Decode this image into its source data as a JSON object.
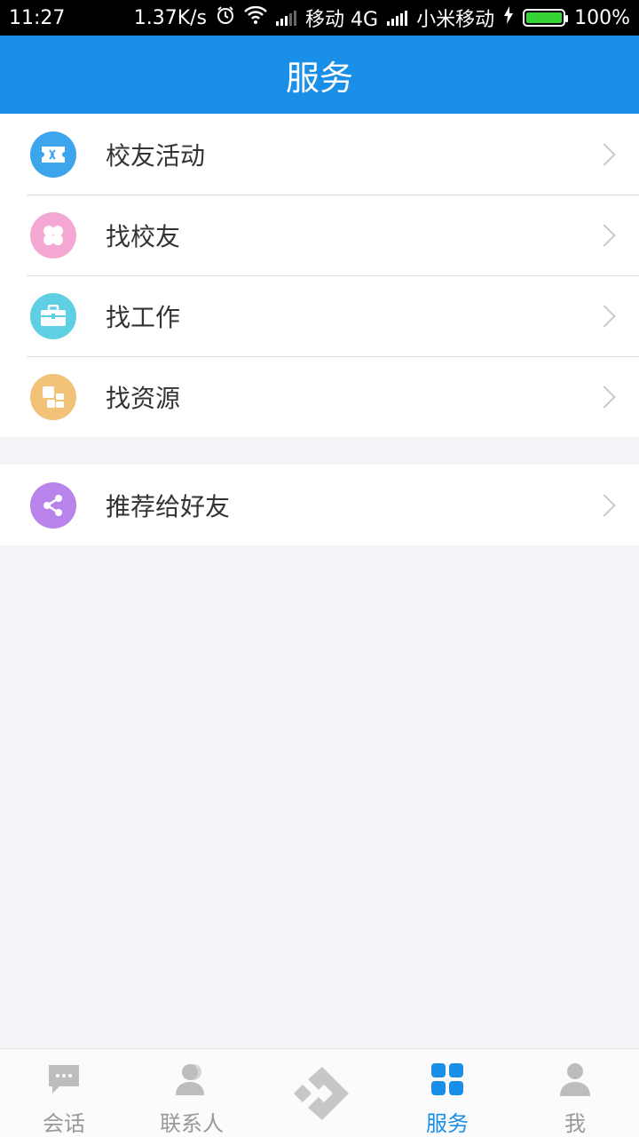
{
  "status_bar": {
    "time": "11:27",
    "speed": "1.37K/s",
    "carrier1": "移动 4G",
    "carrier2": "小米移动",
    "battery": "100%",
    "battery_level": 1.0
  },
  "header": {
    "title": "服务"
  },
  "menu_primary": [
    {
      "label": "校友活动",
      "icon": "ticket-icon",
      "color": "#3da5ec"
    },
    {
      "label": "找校友",
      "icon": "clover-icon",
      "color": "#f4a7d3"
    },
    {
      "label": "找工作",
      "icon": "briefcase-icon",
      "color": "#5fcfe4"
    },
    {
      "label": "找资源",
      "icon": "blocks-icon",
      "color": "#f1c278"
    }
  ],
  "menu_secondary": [
    {
      "label": "推荐给好友",
      "icon": "share-icon",
      "color": "#b883ea"
    }
  ],
  "tabbar": {
    "tabs": [
      {
        "label": "会话",
        "icon": "chat-icon"
      },
      {
        "label": "联系人",
        "icon": "contacts-icon"
      },
      {
        "label": "",
        "icon": "logo-icon"
      },
      {
        "label": "服务",
        "icon": "services-grid-icon",
        "active": true
      },
      {
        "label": "我",
        "icon": "person-icon"
      }
    ],
    "accent": "#1a8fe8",
    "inactive": "#999999"
  }
}
